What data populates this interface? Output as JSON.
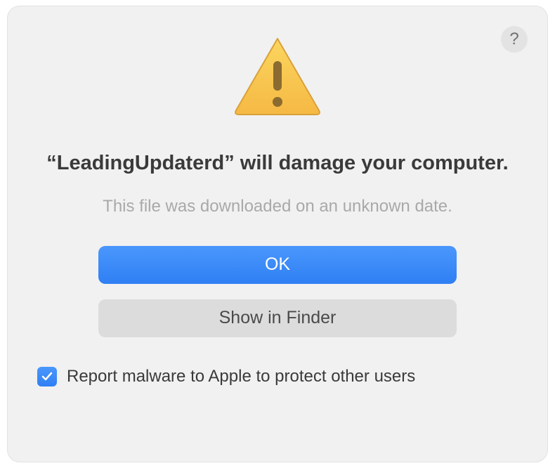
{
  "dialog": {
    "title": "“LeadingUpdaterd” will damage your computer.",
    "subtitle": "This file was downloaded on an unknown date.",
    "help_label": "?",
    "buttons": {
      "ok": "OK",
      "show_in_finder": "Show in Finder"
    },
    "checkbox": {
      "checked": true,
      "label": "Report malware to Apple to protect other users"
    }
  }
}
